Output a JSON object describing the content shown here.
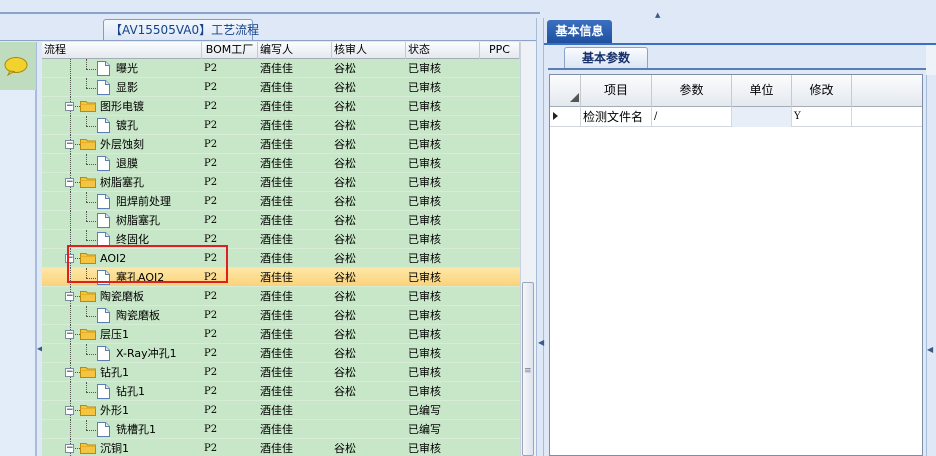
{
  "left_panel": {
    "tab_title": "【AV15505VA0】工艺流程",
    "columns": {
      "name": "流程",
      "bom": "BOM工厂",
      "writer": "编写人",
      "reviewer": "核审人",
      "status": "状态",
      "ppc": "PPC"
    },
    "rows": [
      {
        "name": "曝光",
        "bom": "P2",
        "writer": "酒佳佳",
        "reviewer": "谷松",
        "status": "已审核",
        "ppc": "",
        "type": "doc"
      },
      {
        "name": "显影",
        "bom": "P2",
        "writer": "酒佳佳",
        "reviewer": "谷松",
        "status": "已审核",
        "ppc": "",
        "type": "doc"
      },
      {
        "name": "图形电镀",
        "bom": "P2",
        "writer": "酒佳佳",
        "reviewer": "谷松",
        "status": "已审核",
        "ppc": "",
        "type": "folder"
      },
      {
        "name": "镀孔",
        "bom": "P2",
        "writer": "酒佳佳",
        "reviewer": "谷松",
        "status": "已审核",
        "ppc": "",
        "type": "doc"
      },
      {
        "name": "外层蚀刻",
        "bom": "P2",
        "writer": "酒佳佳",
        "reviewer": "谷松",
        "status": "已审核",
        "ppc": "",
        "type": "folder"
      },
      {
        "name": "退膜",
        "bom": "P2",
        "writer": "酒佳佳",
        "reviewer": "谷松",
        "status": "已审核",
        "ppc": "",
        "type": "doc"
      },
      {
        "name": "树脂塞孔",
        "bom": "P2",
        "writer": "酒佳佳",
        "reviewer": "谷松",
        "status": "已审核",
        "ppc": "",
        "type": "folder"
      },
      {
        "name": "阻焊前处理",
        "bom": "P2",
        "writer": "酒佳佳",
        "reviewer": "谷松",
        "status": "已审核",
        "ppc": "",
        "type": "doc"
      },
      {
        "name": "树脂塞孔",
        "bom": "P2",
        "writer": "酒佳佳",
        "reviewer": "谷松",
        "status": "已审核",
        "ppc": "",
        "type": "doc"
      },
      {
        "name": "终固化",
        "bom": "P2",
        "writer": "酒佳佳",
        "reviewer": "谷松",
        "status": "已审核",
        "ppc": "",
        "type": "doc"
      },
      {
        "name": "AOI2",
        "bom": "P2",
        "writer": "酒佳佳",
        "reviewer": "谷松",
        "status": "已审核",
        "ppc": "",
        "type": "folder"
      },
      {
        "name": "塞孔AOI2",
        "bom": "P2",
        "writer": "酒佳佳",
        "reviewer": "谷松",
        "status": "已审核",
        "ppc": "",
        "type": "doc"
      },
      {
        "name": "陶瓷磨板",
        "bom": "P2",
        "writer": "酒佳佳",
        "reviewer": "谷松",
        "status": "已审核",
        "ppc": "",
        "type": "folder"
      },
      {
        "name": "陶瓷磨板",
        "bom": "P2",
        "writer": "酒佳佳",
        "reviewer": "谷松",
        "status": "已审核",
        "ppc": "",
        "type": "doc"
      },
      {
        "name": "层压1",
        "bom": "P2",
        "writer": "酒佳佳",
        "reviewer": "谷松",
        "status": "已审核",
        "ppc": "",
        "type": "folder"
      },
      {
        "name": "X-Ray冲孔1",
        "bom": "P2",
        "writer": "酒佳佳",
        "reviewer": "谷松",
        "status": "已审核",
        "ppc": "",
        "type": "doc"
      },
      {
        "name": "钻孔1",
        "bom": "P2",
        "writer": "酒佳佳",
        "reviewer": "谷松",
        "status": "已审核",
        "ppc": "",
        "type": "folder"
      },
      {
        "name": "钻孔1",
        "bom": "P2",
        "writer": "酒佳佳",
        "reviewer": "谷松",
        "status": "已审核",
        "ppc": "",
        "type": "doc"
      },
      {
        "name": "外形1",
        "bom": "P2",
        "writer": "酒佳佳",
        "reviewer": "",
        "status": "已编写",
        "ppc": "",
        "type": "folder"
      },
      {
        "name": "铣槽孔1",
        "bom": "P2",
        "writer": "酒佳佳",
        "reviewer": "",
        "status": "已编写",
        "ppc": "",
        "type": "doc"
      },
      {
        "name": "沉铜1",
        "bom": "P2",
        "writer": "酒佳佳",
        "reviewer": "谷松",
        "status": "已审核",
        "ppc": "",
        "type": "folder"
      }
    ]
  },
  "right_panel": {
    "tab_title": "基本信息",
    "subtab_title": "基本参数",
    "columns": {
      "item": "项目",
      "param": "参数",
      "unit": "单位",
      "modify": "修改"
    },
    "rows": [
      {
        "item": "检测文件名",
        "param": "/",
        "unit": "",
        "modify": "Y"
      }
    ]
  },
  "colors": {
    "tree_bg": "#c8e6c8",
    "selected_row": "#fbd27a",
    "highlight_box": "#e02020",
    "tab_blue": "#1d4f9e"
  }
}
